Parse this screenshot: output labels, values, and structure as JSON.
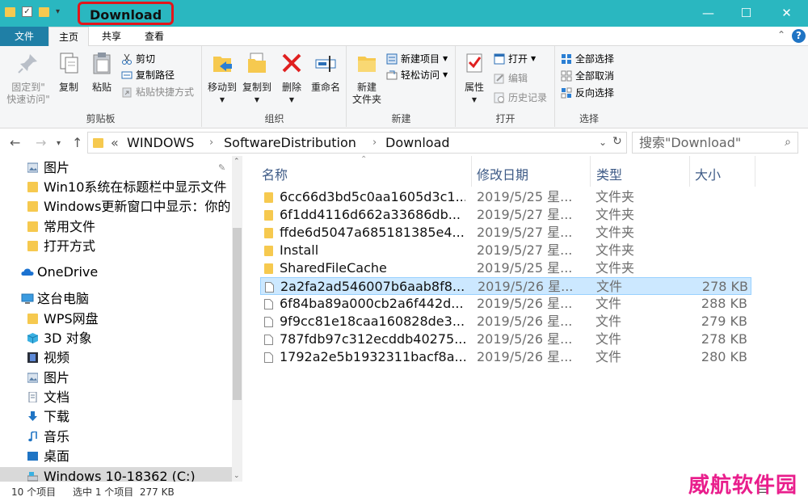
{
  "window": {
    "title": "Download",
    "controls": {
      "minimize": "—",
      "maximize": "☐",
      "close": "✕"
    }
  },
  "tabs": [
    {
      "label": "文件"
    },
    {
      "label": "主页"
    },
    {
      "label": "共享"
    },
    {
      "label": "查看"
    }
  ],
  "ribbon": {
    "clipboard": {
      "label": "剪贴板",
      "pin_line1": "固定到\"",
      "pin_line2": "快速访问\"",
      "copy": "复制",
      "paste": "粘贴",
      "cut": "剪切",
      "copy_path": "复制路径",
      "paste_shortcut": "粘贴快捷方式"
    },
    "organize": {
      "label": "组织",
      "move_to": "移动到",
      "copy_to": "复制到",
      "delete": "删除",
      "rename": "重命名"
    },
    "new": {
      "label": "新建",
      "new_folder_line1": "新建",
      "new_folder_line2": "文件夹",
      "new_item": "新建项目",
      "easy_access": "轻松访问"
    },
    "open": {
      "label": "打开",
      "properties": "属性",
      "open": "打开",
      "edit": "编辑",
      "history": "历史记录"
    },
    "select": {
      "label": "选择",
      "select_all": "全部选择",
      "select_none": "全部取消",
      "invert": "反向选择"
    }
  },
  "address": {
    "crumbs": [
      "«",
      "WINDOWS",
      "SoftwareDistribution",
      "Download"
    ],
    "search_placeholder": "搜索\"Download\""
  },
  "nav": {
    "quick": [
      {
        "label": "图片",
        "icon": "pictures-icon",
        "pinned": true
      },
      {
        "label": "Win10系统在标题栏中显示文件",
        "icon": "folder-icon"
      },
      {
        "label": "Windows更新窗口中显示：你的",
        "icon": "folder-icon"
      },
      {
        "label": "常用文件",
        "icon": "folder-icon"
      },
      {
        "label": "打开方式",
        "icon": "folder-icon"
      }
    ],
    "onedrive": "OneDrive",
    "thispc": "这台电脑",
    "pc_items": [
      {
        "label": "WPS网盘",
        "icon": "wps-cloud-icon"
      },
      {
        "label": "3D 对象",
        "icon": "3d-objects-icon"
      },
      {
        "label": "视频",
        "icon": "videos-icon"
      },
      {
        "label": "图片",
        "icon": "pictures-icon"
      },
      {
        "label": "文档",
        "icon": "documents-icon"
      },
      {
        "label": "下载",
        "icon": "downloads-icon"
      },
      {
        "label": "音乐",
        "icon": "music-icon"
      },
      {
        "label": "桌面",
        "icon": "desktop-icon"
      },
      {
        "label": "Windows 10-18362 (C:)",
        "icon": "drive-icon"
      }
    ]
  },
  "columns": {
    "name": "名称",
    "date": "修改日期",
    "type": "类型",
    "size": "大小"
  },
  "files": [
    {
      "name": "6cc66d3bd5c0aa1605d3c1...",
      "date": "2019/5/25 星...",
      "type": "文件夹",
      "size": "",
      "kind": "folder"
    },
    {
      "name": "6f1dd4116d662a33686db...",
      "date": "2019/5/27 星...",
      "type": "文件夹",
      "size": "",
      "kind": "folder"
    },
    {
      "name": "ffde6d5047a685181385e4...",
      "date": "2019/5/27 星...",
      "type": "文件夹",
      "size": "",
      "kind": "folder"
    },
    {
      "name": "Install",
      "date": "2019/5/27 星...",
      "type": "文件夹",
      "size": "",
      "kind": "folder"
    },
    {
      "name": "SharedFileCache",
      "date": "2019/5/25 星...",
      "type": "文件夹",
      "size": "",
      "kind": "folder"
    },
    {
      "name": "2a2fa2ad546007b6aab8f8...",
      "date": "2019/5/26 星...",
      "type": "文件",
      "size": "278 KB",
      "kind": "file",
      "selected": true
    },
    {
      "name": "6f84ba89a000cb2a6f442d...",
      "date": "2019/5/26 星...",
      "type": "文件",
      "size": "288 KB",
      "kind": "file"
    },
    {
      "name": "9f9cc81e18caa160828de3...",
      "date": "2019/5/26 星...",
      "type": "文件",
      "size": "279 KB",
      "kind": "file"
    },
    {
      "name": "787fdb97c312ecddb40275...",
      "date": "2019/5/26 星...",
      "type": "文件",
      "size": "278 KB",
      "kind": "file"
    },
    {
      "name": "1792a2e5b1932311bacf8a...",
      "date": "2019/5/26 星...",
      "type": "文件",
      "size": "280 KB",
      "kind": "file"
    }
  ],
  "status": {
    "count": "10 个项目",
    "selection": "选中 1 个项目  277 KB"
  },
  "watermark": "威航软件园",
  "colors": {
    "titlebar": "#2ab7c0",
    "file_tab": "#1f7fa6",
    "selection": "#cce8ff",
    "highlight": "#e3151a",
    "folder": "#f6c94f"
  }
}
